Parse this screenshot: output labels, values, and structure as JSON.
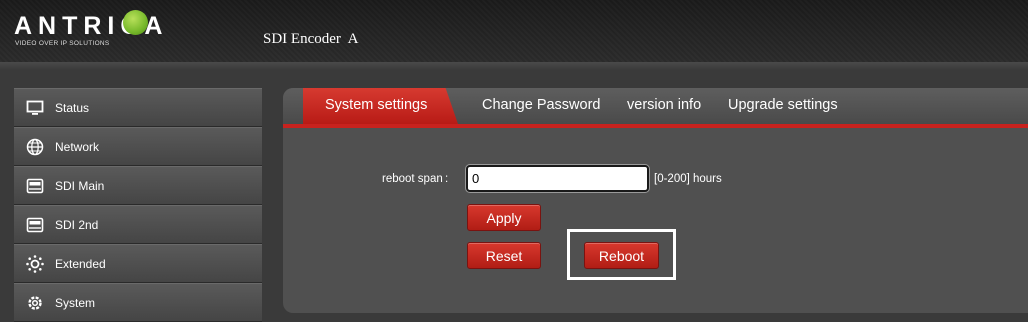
{
  "header": {
    "logo_text": "ANTRICA",
    "logo_tagline": "VIDEO OVER IP SOLUTIONS",
    "device_name": "SDI Encoder  A"
  },
  "sidebar": {
    "items": [
      {
        "label": "Status",
        "icon": "monitor-icon"
      },
      {
        "label": "Network",
        "icon": "globe-icon"
      },
      {
        "label": "SDI Main",
        "icon": "hard-drive-icon"
      },
      {
        "label": "SDI 2nd",
        "icon": "hard-drive-icon"
      },
      {
        "label": "Extended",
        "icon": "gear-dotted-icon"
      },
      {
        "label": "System",
        "icon": "gear-icon"
      }
    ]
  },
  "tabs": {
    "active": "System settings",
    "items": [
      "Change Password",
      "version info",
      "Upgrade settings"
    ]
  },
  "form": {
    "reboot_span_label": "reboot span",
    "colon": ":",
    "reboot_span_value": "0",
    "reboot_span_hint": "[0-200] hours",
    "apply_label": "Apply",
    "reset_label": "Reset",
    "reboot_label": "Reboot"
  },
  "colors": {
    "accent": "#c8221e",
    "logo_green": "#76b82a"
  }
}
